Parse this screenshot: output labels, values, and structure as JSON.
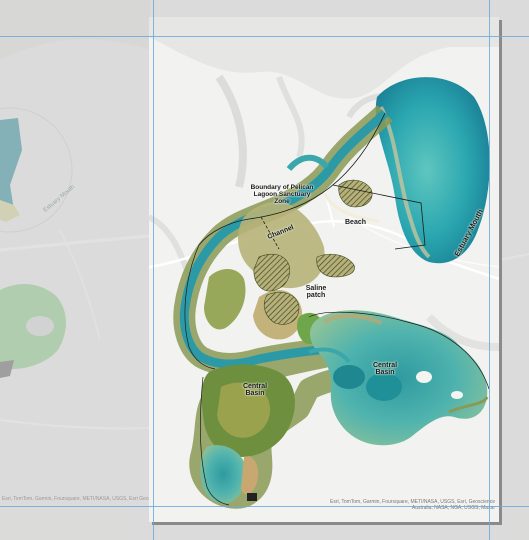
{
  "map": {
    "labels": {
      "boundary": "Boundary of Pelican Lagoon Sanctuary Zone",
      "channel": "Channel",
      "beach": "Beach",
      "estuary_mouth": "Estuary Mouth",
      "saline_patch": "Saline patch",
      "central_basin_west": "Central Basin",
      "central_basin_east": "Central Basin"
    },
    "attribution": "Esri, TomTom, Garmin, Foursquare, METI/NASA, USGS, Esri, Geoscience Australia, NASA, NGA, USGS, Maxar"
  },
  "canvas": {
    "attribution": "Esri, TomTom, Garmin, Foursquare, METI/NASA, USGS, Esri Geoscience Australia",
    "label": "Estuary Mouth"
  },
  "colors": {
    "water_deep": "#1e9aa8",
    "water_shallow": "#6fc3c0",
    "wetland_green": "#7fa84a",
    "sand": "#c9b07a",
    "hatch": "#3c4a20",
    "guide": "#6fa8dc"
  }
}
